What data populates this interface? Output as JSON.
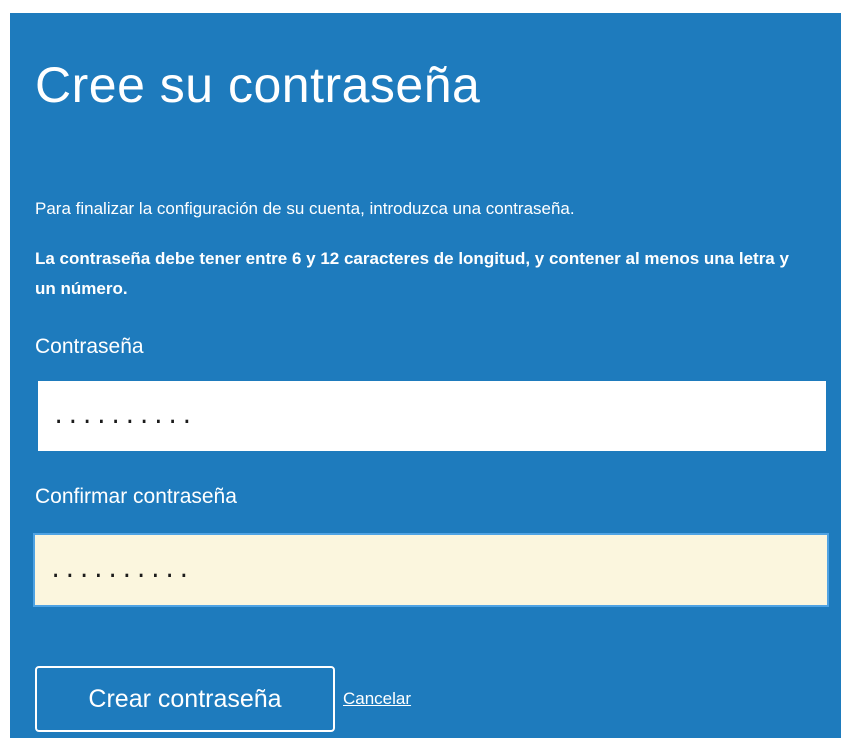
{
  "form": {
    "title": "Cree su contraseña",
    "intro": "Para finalizar la configuración de su cuenta, introduzca una contraseña.",
    "rule": "La contraseña debe tener entre 6 y 12 caracteres de longitud, y contener al menos una letra y un número.",
    "password_label": "Contraseña",
    "password_value": "..........",
    "confirm_label": "Confirmar contraseña",
    "confirm_value": "..........",
    "submit_label": "Crear contraseña",
    "cancel_label": "Cancelar"
  },
  "colors": {
    "panel_background": "#1e7bbd",
    "confirm_field_background": "#fbf6de",
    "focus_border": "#4fa3e3"
  }
}
